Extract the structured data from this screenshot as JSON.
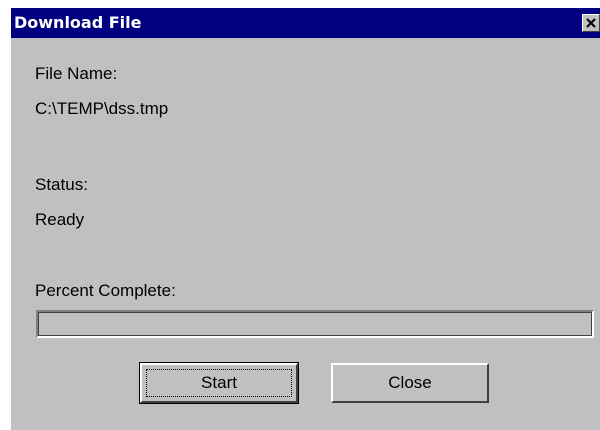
{
  "window": {
    "title": "Download File",
    "close_icon": "close-icon",
    "titlebar_color": "#000080",
    "face_color": "#c0c0c0"
  },
  "fields": {
    "file_name_label": "File Name:",
    "file_name_value": "C:\\TEMP\\dss.tmp",
    "status_label": "Status:",
    "status_value": "Ready",
    "percent_label": "Percent Complete:",
    "percent_complete": 0
  },
  "buttons": {
    "start_label": "Start",
    "close_label": "Close"
  }
}
